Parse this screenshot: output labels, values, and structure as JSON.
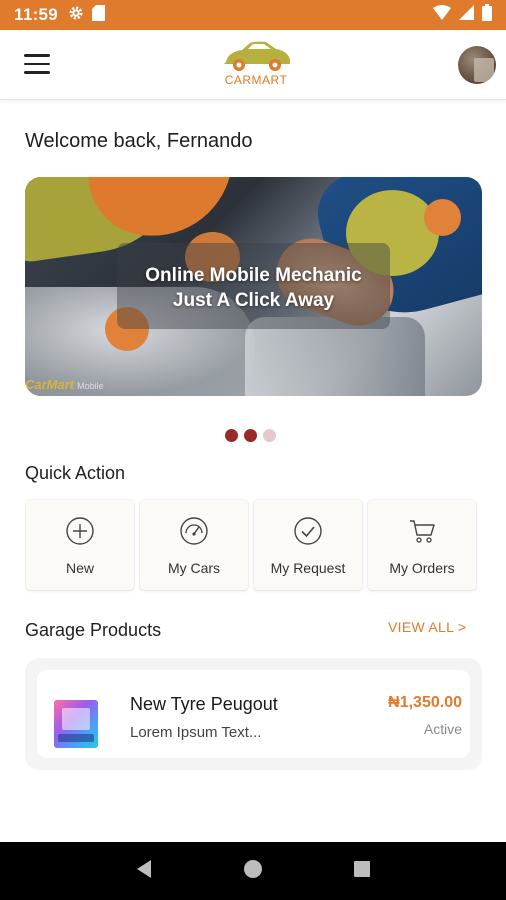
{
  "status_bar": {
    "time": "11:59",
    "icons": [
      "gear-icon",
      "sd-card-icon",
      "wifi-icon",
      "signal-icon",
      "battery-icon"
    ]
  },
  "app_bar": {
    "logo_text": "CARMART",
    "menu_icon": "hamburger-menu-icon",
    "avatar": "user-avatar"
  },
  "welcome": "Welcome back, Fernando",
  "banner": {
    "headline_line1": "Online Mobile Mechanic",
    "headline_line2": "Just A Click Away",
    "brand": "CarMart",
    "brand_small": "Mobile",
    "slide_count": 3,
    "active_slides": [
      0,
      1
    ]
  },
  "quick_action": {
    "title": "Quick Action",
    "items": [
      {
        "label": "New",
        "icon": "plus-circle-icon"
      },
      {
        "label": "My Cars",
        "icon": "speedometer-icon"
      },
      {
        "label": "My Request",
        "icon": "check-circle-icon"
      },
      {
        "label": "My Orders",
        "icon": "cart-icon"
      }
    ]
  },
  "garage_products": {
    "title": "Garage Products",
    "view_all": "VIEW ALL >",
    "items": [
      {
        "name": "New Tyre Peugout",
        "description": "Lorem Ipsum Text...",
        "price": "₦1,350.00",
        "status": "Active"
      }
    ]
  },
  "colors": {
    "accent": "#e07a2c",
    "dot_active": "#9a2a2a",
    "dot_inactive": "#e6c9cc"
  }
}
